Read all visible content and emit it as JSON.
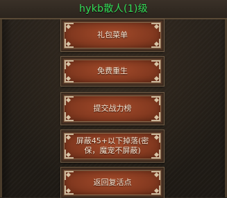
{
  "header": {
    "title": "hykb散人(1)级"
  },
  "menu": {
    "items": [
      {
        "label": "礼包菜单"
      },
      {
        "label": "免费重生"
      },
      {
        "label": "提交战力榜"
      },
      {
        "label": "屏蔽45+以下掉落(密保，魔宠不屏蔽)"
      },
      {
        "label": "返回复活点"
      }
    ]
  }
}
